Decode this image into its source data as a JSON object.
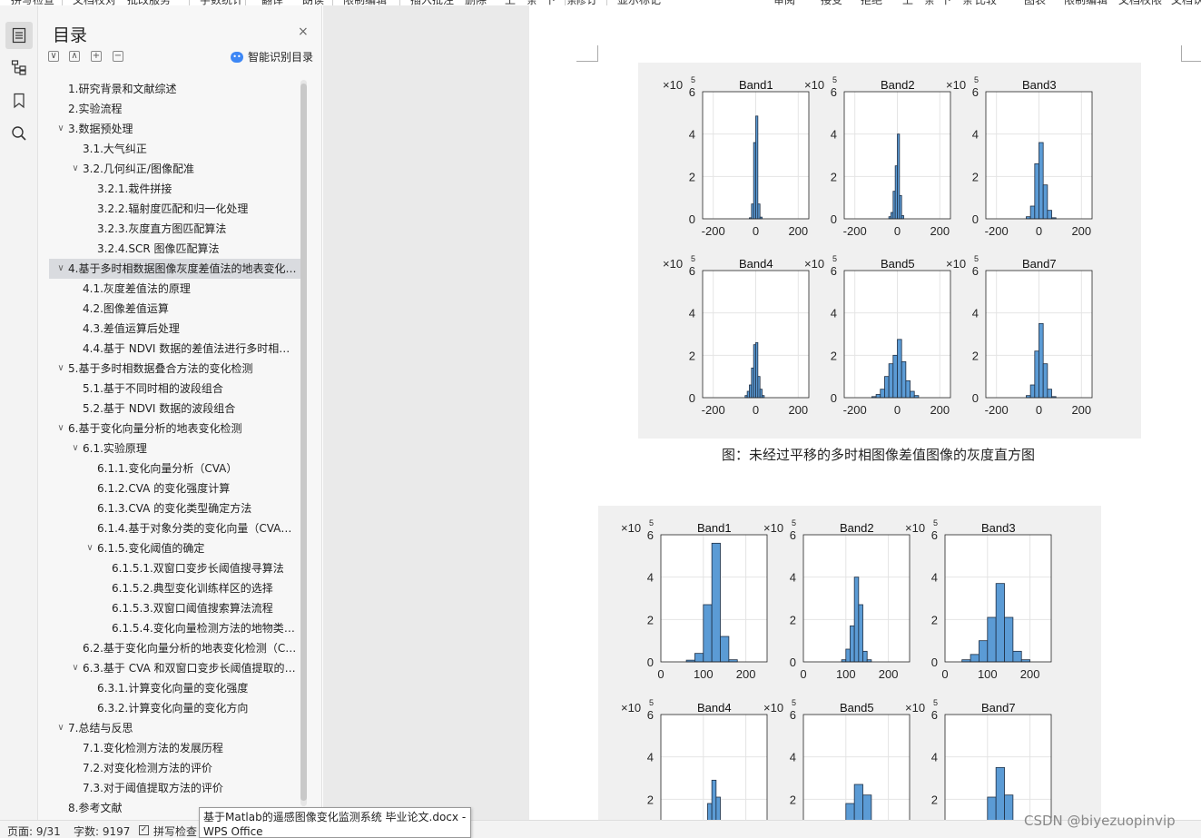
{
  "ribbon": {
    "items": [
      "拼写检查",
      "文档校对",
      "批改服务",
      "字数统计",
      "翻译",
      "朗读",
      "限制编辑",
      "插入批注",
      "删除",
      "上一条",
      "下一条",
      "修订",
      "显示标记",
      "审阅",
      "接受",
      "拒绝",
      "上一条",
      "下一条",
      "比较",
      "图表",
      "限制编辑",
      "文档权限",
      "文档认证"
    ]
  },
  "rail": {
    "toc_icon": "toc-icon",
    "nav_icon": "outline-icon",
    "bookmark_icon": "bookmark-icon",
    "search_icon": "search-icon"
  },
  "toc": {
    "title": "目录",
    "close": "×",
    "tool_icons": [
      "∨",
      "∧",
      "+",
      "−"
    ],
    "smart_label": "智能识别目录",
    "items": [
      {
        "text": "1.研究背景和文献综述",
        "level": 0,
        "chev": ""
      },
      {
        "text": "2.实验流程",
        "level": 0,
        "chev": ""
      },
      {
        "text": "3.数据预处理",
        "level": 0,
        "chev": "∨"
      },
      {
        "text": "3.1.大气纠正",
        "level": 1,
        "chev": ""
      },
      {
        "text": "3.2.几何纠正/图像配准",
        "level": 1,
        "chev": "∨"
      },
      {
        "text": "3.2.1.栽件拼接",
        "level": 2,
        "chev": ""
      },
      {
        "text": "3.2.2.辐射度匹配和归一化处理",
        "level": 2,
        "chev": ""
      },
      {
        "text": "3.2.3.灰度直方图匹配算法",
        "level": 2,
        "chev": ""
      },
      {
        "text": "3.2.4.SCR 图像匹配算法",
        "level": 2,
        "chev": ""
      },
      {
        "text": "4.基于多时相数据图像灰度差值法的地表变化检测",
        "level": 0,
        "chev": "∨",
        "selected": true
      },
      {
        "text": "4.1.灰度差值法的原理",
        "level": 1,
        "chev": ""
      },
      {
        "text": "4.2.图像差值运算",
        "level": 1,
        "chev": ""
      },
      {
        "text": "4.3.差值运算后处理",
        "level": 1,
        "chev": ""
      },
      {
        "text": "4.4.基于 NDVI 数据的差值法进行多时相变化检测",
        "level": 1,
        "chev": ""
      },
      {
        "text": "5.基于多时相数据叠合方法的变化检测",
        "level": 0,
        "chev": "∨"
      },
      {
        "text": "5.1.基于不同时相的波段组合",
        "level": 1,
        "chev": ""
      },
      {
        "text": "5.2.基于 NDVI 数据的波段组合",
        "level": 1,
        "chev": ""
      },
      {
        "text": "6.基于变化向量分析的地表变化检测",
        "level": 0,
        "chev": "∨"
      },
      {
        "text": "6.1.实验原理",
        "level": 1,
        "chev": "∨"
      },
      {
        "text": "6.1.1.变化向量分析（CVA）",
        "level": 2,
        "chev": ""
      },
      {
        "text": "6.1.2.CVA 的变化强度计算",
        "level": 2,
        "chev": ""
      },
      {
        "text": "6.1.3.CVA 的变化类型确定方法",
        "level": 2,
        "chev": ""
      },
      {
        "text": "6.1.4.基于对象分类的变化向量（CVA）分析方法",
        "level": 2,
        "chev": ""
      },
      {
        "text": "6.1.5.变化阈值的确定",
        "level": 2,
        "chev": "∨"
      },
      {
        "text": "6.1.5.1.双窗口变步长阈值搜寻算法",
        "level": 3,
        "chev": ""
      },
      {
        "text": "6.1.5.2.典型变化训练样区的选择",
        "level": 3,
        "chev": ""
      },
      {
        "text": "6.1.5.3.双窗口阈值搜索算法流程",
        "level": 3,
        "chev": ""
      },
      {
        "text": "6.1.5.4.变化向量检测方法的地物类型分析",
        "level": 3,
        "chev": ""
      },
      {
        "text": "6.2.基于变化向量分析的地表变化检测（CVA）",
        "level": 1,
        "chev": ""
      },
      {
        "text": "6.3.基于 CVA 和双窗口变步长阈值提取的变化检测",
        "level": 1,
        "chev": "∨"
      },
      {
        "text": "6.3.1.计算变化向量的变化强度",
        "level": 2,
        "chev": ""
      },
      {
        "text": "6.3.2.计算变化向量的变化方向",
        "level": 2,
        "chev": ""
      },
      {
        "text": "7.总结与反思",
        "level": 0,
        "chev": "∨"
      },
      {
        "text": "7.1.变化检测方法的发展历程",
        "level": 1,
        "chev": ""
      },
      {
        "text": "7.2.对变化检测方法的评价",
        "level": 1,
        "chev": ""
      },
      {
        "text": "7.3.对于阈值提取方法的评价",
        "level": 1,
        "chev": ""
      },
      {
        "text": "8.参考文献",
        "level": 0,
        "chev": ""
      }
    ]
  },
  "status": {
    "page": "页面: 9/31",
    "words": "字数: 9197",
    "spell": "拼写检查",
    "check": "✓"
  },
  "tooltip": {
    "line1": "基于Matlab的遥感图像变化监测系统 毕业论文.docx -",
    "line2": "WPS Office"
  },
  "watermark": "CSDN @biyezuopinvip",
  "document": {
    "caption1": "图：未经过平移的多时相图像差值图像的灰度直方图"
  },
  "chart_data": [
    {
      "type": "bar",
      "figure": "未平移差值直方图",
      "panels": [
        {
          "title": "Band1",
          "multiplier": "×10",
          "exponent": "5",
          "xlim": [
            -250,
            250
          ],
          "ylim": [
            0,
            6
          ],
          "xticks": [
            -200,
            0,
            200
          ],
          "yticks": [
            0,
            2,
            4,
            6
          ],
          "bins": [
            {
              "x": -30,
              "w": 10,
              "y": 0.05
            },
            {
              "x": -20,
              "w": 10,
              "y": 0.7
            },
            {
              "x": -10,
              "w": 10,
              "y": 3.6
            },
            {
              "x": 0,
              "w": 10,
              "y": 4.85
            },
            {
              "x": 10,
              "w": 10,
              "y": 0.7
            },
            {
              "x": 20,
              "w": 10,
              "y": 0.08
            }
          ]
        },
        {
          "title": "Band2",
          "multiplier": "×10",
          "exponent": "5",
          "xlim": [
            -250,
            250
          ],
          "ylim": [
            0,
            6
          ],
          "xticks": [
            -200,
            0,
            200
          ],
          "yticks": [
            0,
            2,
            4,
            6
          ],
          "bins": [
            {
              "x": -40,
              "w": 10,
              "y": 0.1
            },
            {
              "x": -30,
              "w": 10,
              "y": 0.3
            },
            {
              "x": -20,
              "w": 10,
              "y": 1.3
            },
            {
              "x": -10,
              "w": 10,
              "y": 2.5
            },
            {
              "x": 0,
              "w": 10,
              "y": 4.0
            },
            {
              "x": 10,
              "w": 10,
              "y": 1.1
            },
            {
              "x": 20,
              "w": 10,
              "y": 0.15
            }
          ]
        },
        {
          "title": "Band3",
          "multiplier": "×10",
          "exponent": "5",
          "xlim": [
            -250,
            250
          ],
          "ylim": [
            0,
            6
          ],
          "xticks": [
            -200,
            0,
            200
          ],
          "yticks": [
            0,
            2,
            4,
            6
          ],
          "bins": [
            {
              "x": -60,
              "w": 20,
              "y": 0.1
            },
            {
              "x": -40,
              "w": 20,
              "y": 0.6
            },
            {
              "x": -20,
              "w": 20,
              "y": 2.6
            },
            {
              "x": 0,
              "w": 20,
              "y": 3.6
            },
            {
              "x": 20,
              "w": 20,
              "y": 1.6
            },
            {
              "x": 40,
              "w": 20,
              "y": 0.4
            },
            {
              "x": 60,
              "w": 20,
              "y": 0.05
            }
          ]
        },
        {
          "title": "Band4",
          "multiplier": "×10",
          "exponent": "5",
          "xlim": [
            -250,
            250
          ],
          "ylim": [
            0,
            6
          ],
          "xticks": [
            -200,
            0,
            200
          ],
          "yticks": [
            0,
            2,
            4,
            6
          ],
          "bins": [
            {
              "x": -50,
              "w": 10,
              "y": 0.1
            },
            {
              "x": -40,
              "w": 10,
              "y": 0.3
            },
            {
              "x": -30,
              "w": 10,
              "y": 0.6
            },
            {
              "x": -20,
              "w": 10,
              "y": 1.4
            },
            {
              "x": -10,
              "w": 10,
              "y": 2.5
            },
            {
              "x": 0,
              "w": 10,
              "y": 2.6
            },
            {
              "x": 10,
              "w": 10,
              "y": 1.0
            },
            {
              "x": 20,
              "w": 10,
              "y": 0.4
            },
            {
              "x": 30,
              "w": 10,
              "y": 0.1
            }
          ]
        },
        {
          "title": "Band5",
          "multiplier": "×10",
          "exponent": "5",
          "xlim": [
            -250,
            250
          ],
          "ylim": [
            0,
            6
          ],
          "xticks": [
            -200,
            0,
            200
          ],
          "yticks": [
            0,
            2,
            4,
            6
          ],
          "bins": [
            {
              "x": -120,
              "w": 20,
              "y": 0.05
            },
            {
              "x": -100,
              "w": 20,
              "y": 0.15
            },
            {
              "x": -80,
              "w": 20,
              "y": 0.4
            },
            {
              "x": -60,
              "w": 20,
              "y": 1.0
            },
            {
              "x": -40,
              "w": 20,
              "y": 1.6
            },
            {
              "x": -20,
              "w": 20,
              "y": 2.0
            },
            {
              "x": 0,
              "w": 20,
              "y": 2.75
            },
            {
              "x": 20,
              "w": 20,
              "y": 1.7
            },
            {
              "x": 40,
              "w": 20,
              "y": 0.8
            },
            {
              "x": 60,
              "w": 20,
              "y": 0.3
            },
            {
              "x": 80,
              "w": 20,
              "y": 0.1
            }
          ]
        },
        {
          "title": "Band7",
          "multiplier": "×10",
          "exponent": "5",
          "xlim": [
            -250,
            250
          ],
          "ylim": [
            0,
            6
          ],
          "xticks": [
            -200,
            0,
            200
          ],
          "yticks": [
            0,
            2,
            4,
            6
          ],
          "bins": [
            {
              "x": -60,
              "w": 20,
              "y": 0.1
            },
            {
              "x": -40,
              "w": 20,
              "y": 0.6
            },
            {
              "x": -20,
              "w": 20,
              "y": 2.2
            },
            {
              "x": 0,
              "w": 20,
              "y": 3.5
            },
            {
              "x": 20,
              "w": 20,
              "y": 1.6
            },
            {
              "x": 40,
              "w": 20,
              "y": 0.4
            },
            {
              "x": 60,
              "w": 20,
              "y": 0.05
            }
          ]
        }
      ]
    },
    {
      "type": "bar",
      "figure": "平移后差值直方图",
      "panels": [
        {
          "title": "Band1",
          "multiplier": "×10",
          "exponent": "5",
          "xlim": [
            0,
            250
          ],
          "ylim": [
            0,
            6
          ],
          "xticks": [
            0,
            100,
            200
          ],
          "yticks": [
            0,
            2,
            4,
            6
          ],
          "bins": [
            {
              "x": 60,
              "w": 20,
              "y": 0.08
            },
            {
              "x": 80,
              "w": 20,
              "y": 0.4
            },
            {
              "x": 100,
              "w": 20,
              "y": 2.7
            },
            {
              "x": 120,
              "w": 20,
              "y": 5.6
            },
            {
              "x": 140,
              "w": 20,
              "y": 1.2
            },
            {
              "x": 160,
              "w": 20,
              "y": 0.1
            }
          ]
        },
        {
          "title": "Band2",
          "multiplier": "×10",
          "exponent": "5",
          "xlim": [
            0,
            250
          ],
          "ylim": [
            0,
            6
          ],
          "xticks": [
            0,
            100,
            200
          ],
          "yticks": [
            0,
            2,
            4,
            6
          ],
          "bins": [
            {
              "x": 90,
              "w": 10,
              "y": 0.1
            },
            {
              "x": 100,
              "w": 10,
              "y": 0.6
            },
            {
              "x": 110,
              "w": 10,
              "y": 1.7
            },
            {
              "x": 120,
              "w": 10,
              "y": 4.0
            },
            {
              "x": 130,
              "w": 10,
              "y": 2.7
            },
            {
              "x": 140,
              "w": 10,
              "y": 0.5
            },
            {
              "x": 150,
              "w": 10,
              "y": 0.1
            }
          ]
        },
        {
          "title": "Band3",
          "multiplier": "×10",
          "exponent": "5",
          "xlim": [
            0,
            250
          ],
          "ylim": [
            0,
            6
          ],
          "xticks": [
            0,
            100,
            200
          ],
          "yticks": [
            0,
            2,
            4,
            6
          ],
          "bins": [
            {
              "x": 40,
              "w": 20,
              "y": 0.1
            },
            {
              "x": 60,
              "w": 20,
              "y": 0.35
            },
            {
              "x": 80,
              "w": 20,
              "y": 1.0
            },
            {
              "x": 100,
              "w": 20,
              "y": 2.1
            },
            {
              "x": 120,
              "w": 20,
              "y": 3.7
            },
            {
              "x": 140,
              "w": 20,
              "y": 2.1
            },
            {
              "x": 160,
              "w": 20,
              "y": 0.5
            },
            {
              "x": 180,
              "w": 20,
              "y": 0.1
            }
          ]
        },
        {
          "title": "Band4",
          "multiplier": "×10",
          "exponent": "5",
          "xlim": [
            0,
            250
          ],
          "ylim": [
            0,
            6
          ],
          "xticks": [
            0,
            100,
            200
          ],
          "yticks": [
            0,
            2,
            4,
            6
          ],
          "bins": [
            {
              "x": 100,
              "w": 10,
              "y": 0.5
            },
            {
              "x": 110,
              "w": 10,
              "y": 1.8
            },
            {
              "x": 120,
              "w": 10,
              "y": 2.9
            },
            {
              "x": 130,
              "w": 10,
              "y": 2.1
            },
            {
              "x": 140,
              "w": 10,
              "y": 0.5
            }
          ]
        },
        {
          "title": "Band5",
          "multiplier": "×10",
          "exponent": "5",
          "xlim": [
            0,
            250
          ],
          "ylim": [
            0,
            6
          ],
          "xticks": [
            0,
            100,
            200
          ],
          "yticks": [
            0,
            2,
            4,
            6
          ],
          "bins": [
            {
              "x": 80,
              "w": 20,
              "y": 0.6
            },
            {
              "x": 100,
              "w": 20,
              "y": 1.8
            },
            {
              "x": 120,
              "w": 20,
              "y": 2.7
            },
            {
              "x": 140,
              "w": 20,
              "y": 2.2
            },
            {
              "x": 160,
              "w": 20,
              "y": 0.6
            }
          ]
        },
        {
          "title": "Band7",
          "multiplier": "×10",
          "exponent": "5",
          "xlim": [
            0,
            250
          ],
          "ylim": [
            0,
            6
          ],
          "xticks": [
            0,
            100,
            200
          ],
          "yticks": [
            0,
            2,
            4,
            6
          ],
          "bins": [
            {
              "x": 80,
              "w": 20,
              "y": 0.4
            },
            {
              "x": 100,
              "w": 20,
              "y": 2.1
            },
            {
              "x": 120,
              "w": 20,
              "y": 3.5
            },
            {
              "x": 140,
              "w": 20,
              "y": 2.2
            },
            {
              "x": 160,
              "w": 20,
              "y": 0.5
            }
          ]
        }
      ]
    }
  ],
  "colors": {
    "bar_fill": "#5b9bd5",
    "bar_stroke": "#1f2f44",
    "figure_bg": "#f0f0f0",
    "selected_row": "#d9dbdf",
    "accent": "#3d87f5"
  }
}
